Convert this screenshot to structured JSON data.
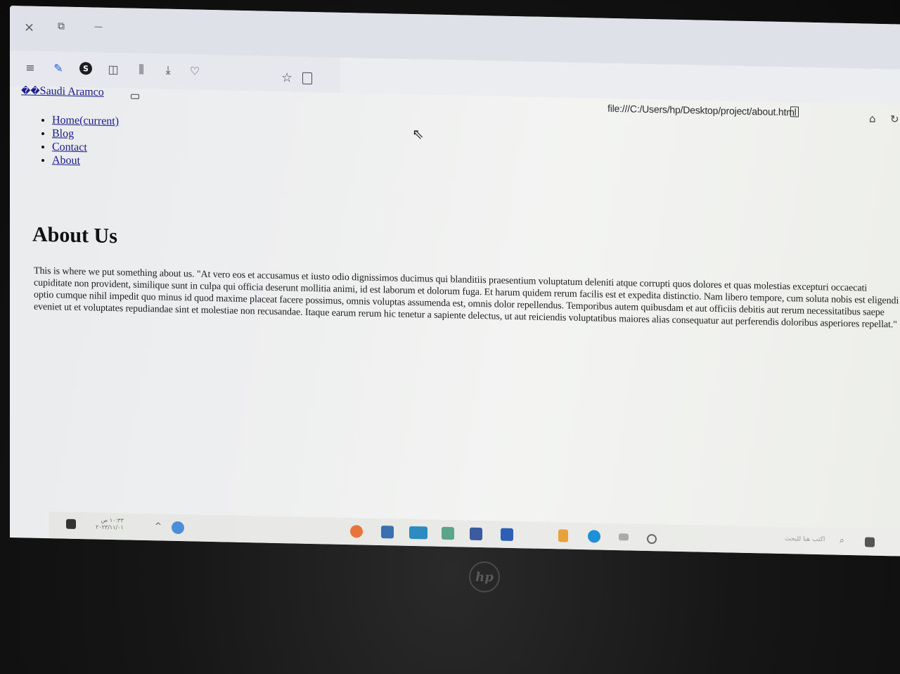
{
  "browser": {
    "url": "file:///C:/Users/hp/Desktop/project/about.html",
    "new_tab": "+",
    "tab_close": "×",
    "window_close": "×",
    "window_restore": "⧉",
    "window_minimize": "—"
  },
  "page": {
    "brand_prefix": "��",
    "brand": "Saudi Aramco",
    "nav": [
      "Home(current)",
      "Blog",
      "Contact",
      "About"
    ],
    "heading": "About Us",
    "paragraph": "This is where we put something about us. \"At vero eos et accusamus et iusto odio dignissimos ducimus qui blanditiis praesentium voluptatum deleniti atque corrupti quos dolores et quas molestias excepturi occaecati cupiditate non provident, similique sunt in culpa qui officia deserunt mollitia animi, id est laborum et dolorum fuga. Et harum quidem rerum facilis est et expedita distinctio. Nam libero tempore, cum soluta nobis est eligendi optio cumque nihil impedit quo minus id quod maxime placeat facere possimus, omnis voluptas assumenda est, omnis dolor repellendus. Temporibus autem quibusdam et aut officiis debitis aut rerum necessitatibus saepe eveniet ut et voluptates repudiandae sint et molestiae non recusandae. Itaque earum rerum hic tenetur a sapiente delectus, ut aut reiciendis voluptatibus maiores alias consequatur aut perferendis doloribus asperiores repellat.\""
  },
  "taskbar": {
    "time": "١٠:٣٣ ص",
    "date": "٢٠٢٣/١١/٠١",
    "search_placeholder": "اكتب هنا للبحث"
  },
  "colors": {
    "link": "#1a1a8a",
    "toolbar": "#e6e8ee",
    "page_bg": "#eeefef"
  },
  "icons": [
    "menu-icon",
    "extension-icon",
    "sync-icon",
    "sidebar-icon",
    "library-icon",
    "download-icon",
    "pocket-icon",
    "bookmark-star-icon",
    "reader-view-icon",
    "home-icon",
    "reload-icon"
  ]
}
